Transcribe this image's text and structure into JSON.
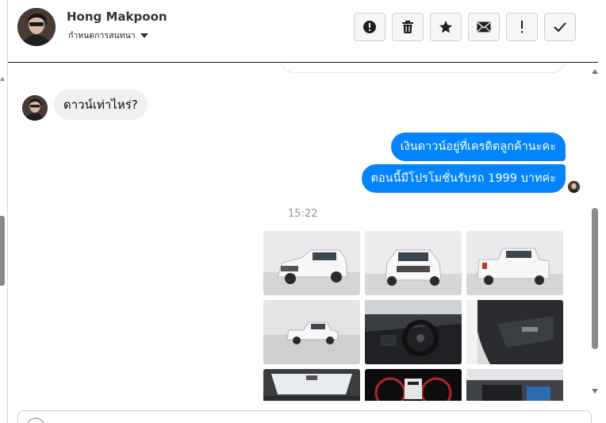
{
  "header": {
    "contact_name": "Hong Makpoon",
    "settings_label": "กำหนดการสนทนา",
    "actions": [
      {
        "name": "spam-button",
        "icon": "alert-circle-icon"
      },
      {
        "name": "delete-button",
        "icon": "trash-icon"
      },
      {
        "name": "star-button",
        "icon": "star-icon"
      },
      {
        "name": "mark-unread-button",
        "icon": "envelope-icon"
      },
      {
        "name": "follow-up-button",
        "icon": "exclamation-icon"
      },
      {
        "name": "done-button",
        "icon": "checkmark-icon"
      }
    ]
  },
  "messages": {
    "incoming_1": "ดาวน์เท่าไหร่?",
    "outgoing_1": "เงินดาวน์อยู่ที่เครดิตลูกค้านะคะ",
    "outgoing_2": "ตอนนี้มีโปรโมชั่นรับรถ 1999 บาทค่ะ",
    "timestamp": "15:22"
  },
  "photos": [
    {
      "name": "photo-truck-front-left",
      "subject": "white pickup truck front-left view"
    },
    {
      "name": "photo-truck-front",
      "subject": "white pickup truck front view"
    },
    {
      "name": "photo-truck-rear",
      "subject": "white pickup truck rear view"
    },
    {
      "name": "photo-truck-side",
      "subject": "white pickup truck side view"
    },
    {
      "name": "photo-dashboard",
      "subject": "steering wheel and dashboard"
    },
    {
      "name": "photo-door-interior",
      "subject": "interior door panel"
    },
    {
      "name": "photo-windshield",
      "subject": "cabin windshield view"
    },
    {
      "name": "photo-gauges",
      "subject": "instrument cluster"
    },
    {
      "name": "photo-engine",
      "subject": "engine bay"
    }
  ],
  "colors": {
    "outgoing_bubble": "#0084ff",
    "incoming_bubble": "#f0f0f0",
    "timestamp": "#8d949e"
  }
}
